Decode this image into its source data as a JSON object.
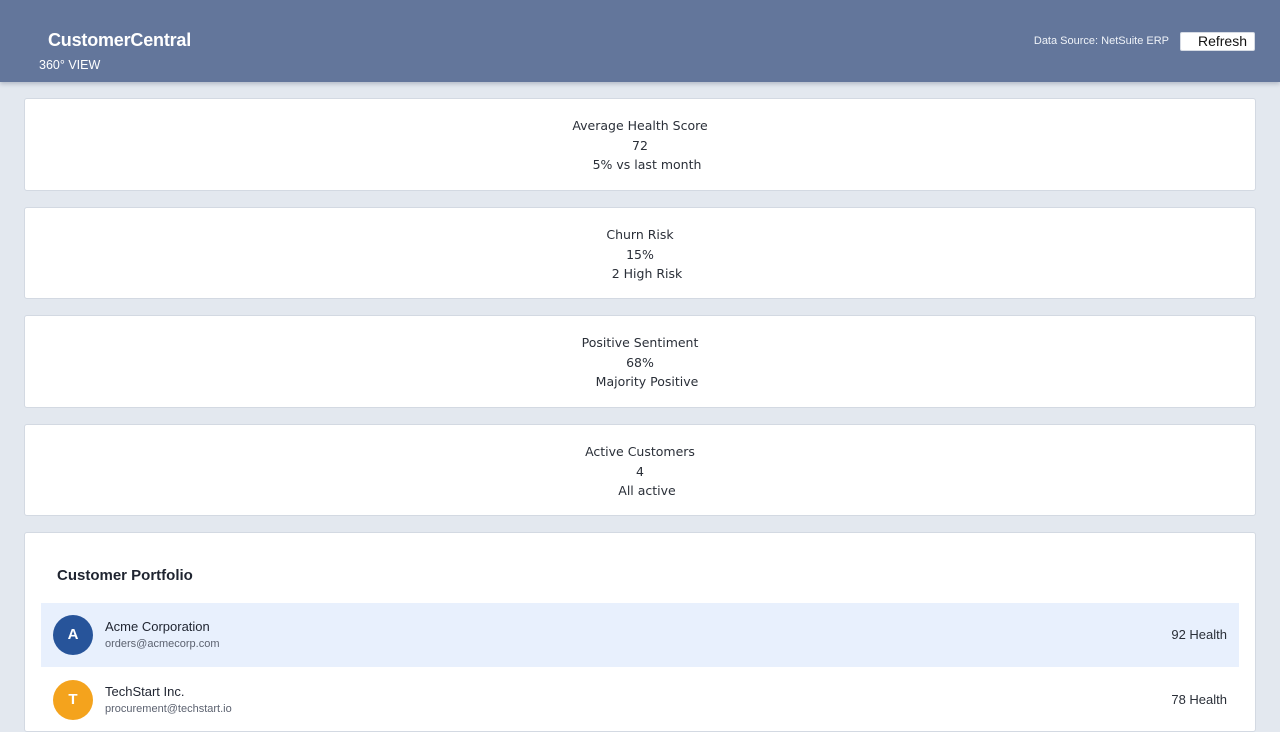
{
  "header": {
    "title": "CustomerCentral",
    "subtitle": "360° VIEW",
    "data_source": "Data Source: NetSuite ERP",
    "refresh_label": "Refresh",
    "background_color": "#63769b"
  },
  "metrics": [
    {
      "label": "Average Health Score",
      "value": "72",
      "sub": "5% vs last month"
    },
    {
      "label": "Churn Risk",
      "value": "15%",
      "sub": "2 High Risk"
    },
    {
      "label": "Positive Sentiment",
      "value": "68%",
      "sub": "Majority Positive"
    },
    {
      "label": "Active Customers",
      "value": "4",
      "sub": "All active"
    }
  ],
  "portfolio": {
    "title": "Customer Portfolio",
    "customers": [
      {
        "initial": "A",
        "name": "Acme Corporation",
        "email": "orders@acmecorp.com",
        "health": "92 Health",
        "avatar_color": "#27549a",
        "selected": true
      },
      {
        "initial": "T",
        "name": "TechStart Inc.",
        "email": "procurement@techstart.io",
        "health": "78 Health",
        "avatar_color": "#f4a31d",
        "selected": false
      }
    ]
  }
}
